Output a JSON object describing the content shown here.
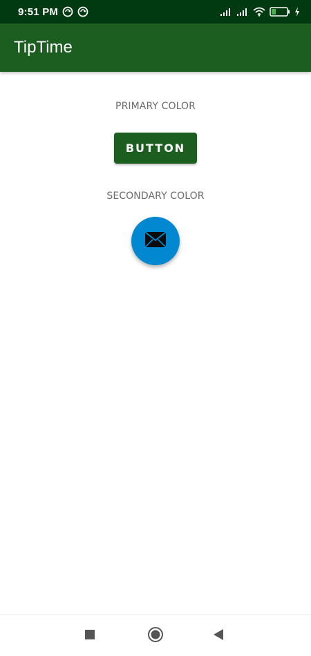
{
  "status_bar": {
    "time": "9:51 PM",
    "battery_level": "24",
    "icons": [
      "sync-icon",
      "sync-icon",
      "signal-icon",
      "signal-icon",
      "wifi-icon",
      "battery-icon",
      "charging-icon"
    ]
  },
  "app_bar": {
    "title": "TipTime",
    "color": "#1b5e20"
  },
  "content": {
    "primary_label": "PRIMARY COLOR",
    "button_label": "BUTTON",
    "secondary_label": "SECONDARY COLOR",
    "fab_icon": "email-icon",
    "primary_color": "#1b5e20",
    "secondary_color": "#0288d1"
  },
  "nav_bar": {
    "buttons": [
      "recent-apps-icon",
      "home-icon",
      "back-icon"
    ]
  }
}
